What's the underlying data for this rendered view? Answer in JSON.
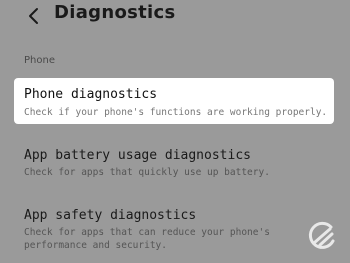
{
  "header": {
    "title": "Diagnostics"
  },
  "section": {
    "label": "Phone"
  },
  "items": [
    {
      "title": "Phone diagnostics",
      "description": "Check if your phone's functions are working properly."
    },
    {
      "title": "App battery usage diagnostics",
      "description": "Check for apps that quickly use up battery."
    },
    {
      "title": "App safety diagnostics",
      "description": "Check for apps that can reduce your phone's performance and security."
    }
  ],
  "colors": {
    "overlay_background": "#9a9a9a",
    "highlight_background": "#ffffff"
  },
  "icons": {
    "back": "chevron-left-icon",
    "watermark": "logo-watermark"
  }
}
